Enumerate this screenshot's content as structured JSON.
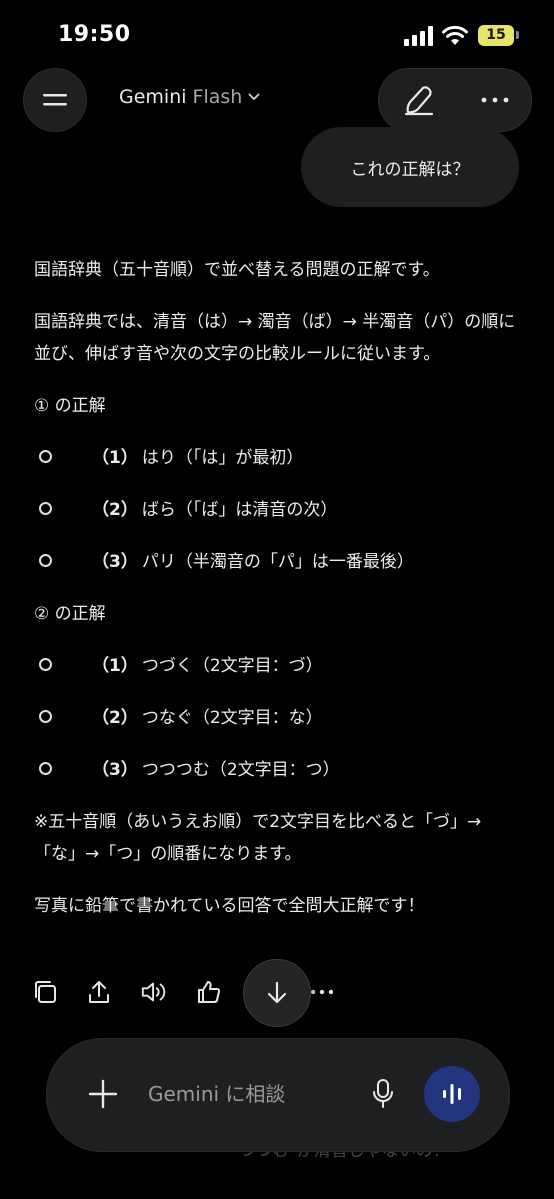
{
  "status_bar": {
    "time": "19:50",
    "battery": "15"
  },
  "header": {
    "model_name": "Gemini",
    "model_variant": "Flash"
  },
  "user_message": "これの正解は？",
  "response": {
    "intro": "国語辞典（五十音順）で並べ替える問題の正解です。",
    "rule": "国語辞典では、清音（は）→ 濁音（ば）→ 半濁音（パ）の順に並び、伸ばす音や次の文字の比較ルールに従います。",
    "section1_title": "① の正解",
    "section1_items": [
      {
        "num": "（1）",
        "text": "はり（「は」が最初）"
      },
      {
        "num": "（2）",
        "text": "ばら（「ば」は清音の次）"
      },
      {
        "num": "（3）",
        "text": "パリ（半濁音の「パ」は一番最後）"
      }
    ],
    "section2_title": "② の正解",
    "section2_items": [
      {
        "num": "（1）",
        "text": "つづく（2文字目：づ）"
      },
      {
        "num": "（2）",
        "text": "つなぐ（2文字目：な）"
      },
      {
        "num": "（3）",
        "text": "つつつむ（2文字目：つ）"
      }
    ],
    "note": "※五十音順（あいうえお順）で2文字目を比べると「づ」→「な」→「つ」の順番になります。",
    "closing": "写真に鉛筆で書かれている回答で全問大正解です！"
  },
  "behind_text": "つづむ\"が清音じゃないの？",
  "input": {
    "placeholder": "Gemini に相談"
  },
  "colors": {
    "background": "#000000",
    "surface": "#1e1f20",
    "accent": "#243580",
    "battery": "#e8e36b"
  },
  "icons": [
    "signal-icon",
    "wifi-icon",
    "menu-icon",
    "chevron-down-icon",
    "edit-icon",
    "more-icon",
    "copy-icon",
    "share-icon",
    "speaker-icon",
    "thumbs-up-icon",
    "arrow-down-icon",
    "plus-icon",
    "mic-icon",
    "live-icon"
  ]
}
